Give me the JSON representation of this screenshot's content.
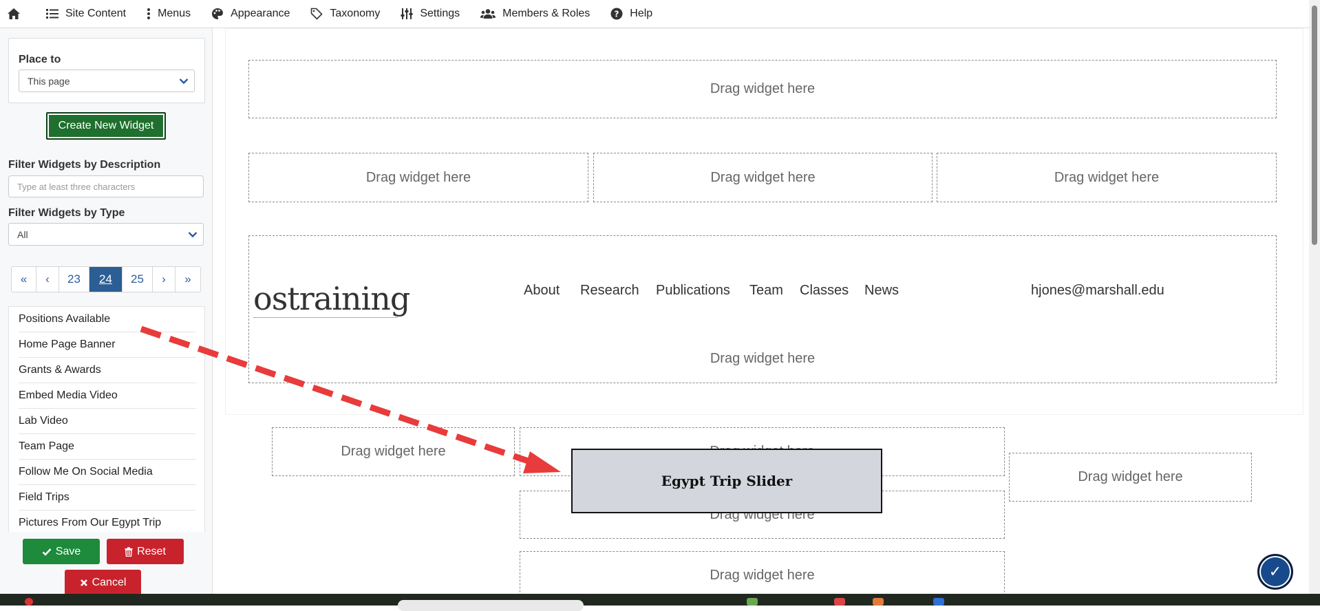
{
  "topnav": {
    "items": [
      {
        "label": "Site Content",
        "icon": "list-icon"
      },
      {
        "label": "Menus",
        "icon": "vertical-dots-icon"
      },
      {
        "label": "Appearance",
        "icon": "palette-icon"
      },
      {
        "label": "Taxonomy",
        "icon": "tag-icon"
      },
      {
        "label": "Settings",
        "icon": "sliders-icon"
      },
      {
        "label": "Members & Roles",
        "icon": "users-icon"
      },
      {
        "label": "Help",
        "icon": "question-circle-icon"
      }
    ]
  },
  "sidebar": {
    "place_to_label": "Place to",
    "place_to_value": "This page",
    "create_button": "Create New Widget",
    "filter_desc_label": "Filter Widgets by Description",
    "filter_desc_placeholder": "Type at least three characters",
    "filter_type_label": "Filter Widgets by Type",
    "filter_type_value": "All",
    "pagination": [
      "«",
      "‹",
      "23",
      "24",
      "25",
      "›",
      "»"
    ],
    "active_page": "24",
    "widgets": [
      "Positions Available",
      "Home Page Banner",
      "Grants & Awards",
      "Embed Media Video",
      "Lab Video",
      "Team Page",
      "Follow Me On Social Media",
      "Field Trips",
      "Pictures From Our Egypt Trip"
    ],
    "save_button": "Save",
    "reset_button": "Reset",
    "cancel_button": "Cancel"
  },
  "canvas": {
    "drop_text": "Drag widget here",
    "logo": "ostraining",
    "nav_links": [
      "About",
      "Research",
      "Publications",
      "Team",
      "Classes",
      "News"
    ],
    "email": "hjones@marshall.edu",
    "dragging_widget": "Egypt Trip Slider"
  },
  "colors": {
    "create_button": "#1f6f2e",
    "save_button": "#1e8a3c",
    "reset_button": "#c8232c",
    "cancel_button": "#c8232c",
    "active_page": "#2b5e94",
    "drag_arrow": "#e83b3b"
  }
}
